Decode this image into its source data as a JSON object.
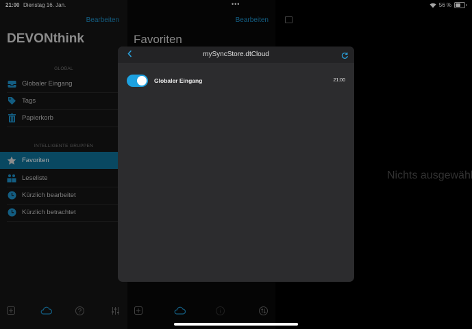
{
  "status_bar": {
    "time": "21:00",
    "date": "Dienstag 16. Jan.",
    "dots": "•••",
    "battery_text": "56 %"
  },
  "sidebar": {
    "edit_label": "Bearbeiten",
    "brand": "DEVONthink",
    "section_global": "GLOBAL",
    "global_items": [
      {
        "label": "Globaler Eingang",
        "icon": "inbox-icon"
      },
      {
        "label": "Tags",
        "icon": "tag-icon"
      },
      {
        "label": "Papierkorb",
        "icon": "trash-icon"
      }
    ],
    "section_smart": "INTELLIGENTE GRUPPEN",
    "smart_items": [
      {
        "label": "Favoriten",
        "icon": "star-icon",
        "selected": true
      },
      {
        "label": "Leseliste",
        "icon": "reading-list-icon"
      },
      {
        "label": "Kürzlich bearbeitet",
        "icon": "clock-icon"
      },
      {
        "label": "Kürzlich betrachtet",
        "icon": "clock-icon"
      }
    ]
  },
  "middle": {
    "edit_label": "Bearbeiten",
    "title": "Favoriten"
  },
  "detail": {
    "empty_text": "Nichts ausgewählt"
  },
  "modal": {
    "title": "mySyncStore.dtCloud",
    "item": {
      "label": "Globaler Eingang",
      "time": "21:00",
      "enabled": true
    }
  },
  "colors": {
    "accent": "#1e8fc7",
    "selection": "#0f6f96",
    "toggle_on": "#1da1e0"
  }
}
